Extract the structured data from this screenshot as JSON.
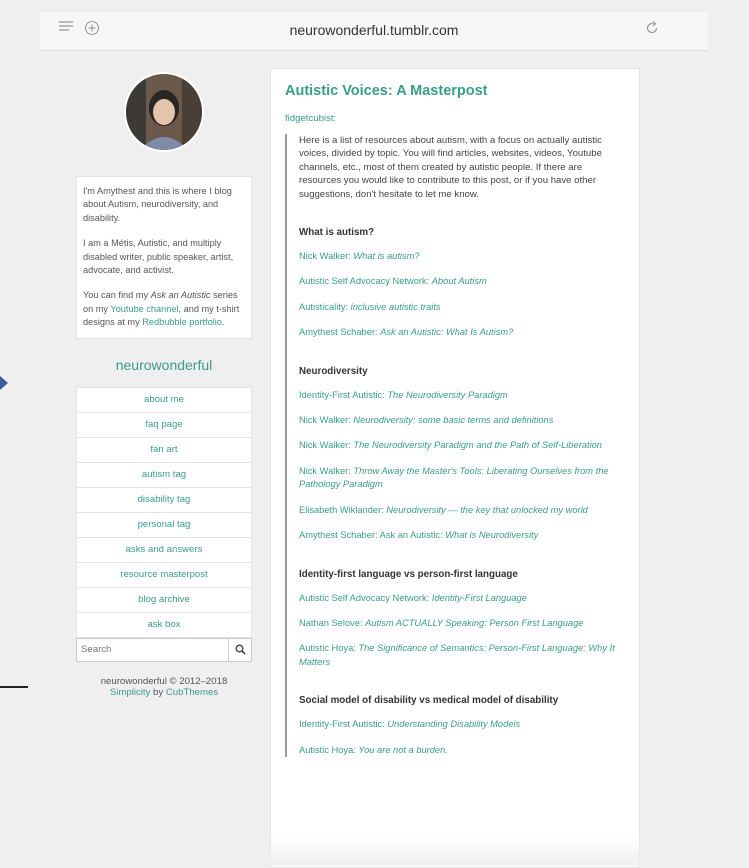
{
  "browser": {
    "url": "neurowonderful.tumblr.com",
    "icons": {
      "reader": "reader-icon",
      "new_tab": "plus-icon",
      "reload": "reload-icon"
    }
  },
  "sidebar": {
    "bio": {
      "p1": "I'm Amythest and this is where I blog about Autism, neurodiversity, and disability.",
      "p2": "I am a Métis, Autistic, and multiply disabled writer, public speaker, artist, advocate, and activist.",
      "p3_pre": "You can find my ",
      "p3_em": "Ask an Autistic",
      "p3_mid": " series on my ",
      "p3_link1": "Youtube channel",
      "p3_mid2": ", and my t-shirt designs at my ",
      "p3_link2": "Redbubble portfolio",
      "p3_end": "."
    },
    "blog_name": "neurowonderful",
    "nav": [
      "about me",
      "faq page",
      "fan art",
      "autism tag",
      "disability tag",
      "personal tag",
      "asks and answers",
      "resource masterpost",
      "blog archive",
      "ask box"
    ],
    "search_placeholder": "Search",
    "footer_copy": "neurowonderful © 2012–2018",
    "footer_theme": "Simplicity",
    "footer_by": " by ",
    "footer_author": "CubThemes"
  },
  "post": {
    "title": "Autistic Voices: A Masterpost",
    "reblog_user": "fidgetcubist:",
    "intro": "Here is a list of resources about autism, with a focus on actually autistic voices, divided by topic. You will find articles, websites, videos, Youtube channels, etc., most of them created by autistic people. If there are resources you would like to contribute to this post, or if you have other suggestions, don't hesitate to let me know.",
    "sections": [
      {
        "heading": "What is autism?",
        "links": [
          {
            "author": "Nick Walker: ",
            "title": "What is autism?"
          },
          {
            "author": "Autistic Self Advocacy Network: ",
            "title": "About Autism"
          },
          {
            "author": "Autisticality: ",
            "title": "inclusive autistic traits"
          },
          {
            "author": "Amythest Schaber: ",
            "title": "Ask an Autistic: What Is Autism?"
          }
        ]
      },
      {
        "heading": "Neurodiversity",
        "links": [
          {
            "author": "Identity-First Autistic: ",
            "title": "The Neurodiversity Paradigm"
          },
          {
            "author": "Nick Walker: ",
            "title": "Neurodiversity: some basic terms and definitions"
          },
          {
            "author": "Nick Walker: ",
            "title": "The Neurodiversity Paradigm and the Path of Self-Liberation"
          },
          {
            "author": "Nick Walker: ",
            "title": "Throw Away the Master's Tools: Liberating Ourselves from the Pathology Paradigm"
          },
          {
            "author": "Elisabeth Wiklander: ",
            "title": "Neurodiversity — the key that unlocked my world"
          },
          {
            "author": "Amythest Schaber: Ask an Autistic: ",
            "title": "What is Neurodiversity"
          }
        ]
      },
      {
        "heading": "Identity-first language vs person-first language",
        "links": [
          {
            "author": "Autistic Self Advocacy Network: ",
            "title": "Identity-First Language"
          },
          {
            "author": "Nathan Selove: ",
            "title": "Autism ACTUALLY Speaking: Person First Language"
          },
          {
            "author": "Autistic Hoya: ",
            "title": "The Significance of Semantics: Person-First Language: Why It Matters"
          }
        ]
      },
      {
        "heading": "Social model of disability vs medical model of disability",
        "links": [
          {
            "author": "Identity-First Autistic: ",
            "title": "Understanding Disability Models"
          },
          {
            "author": "Autistic Hoya: ",
            "title": "You are not a burden."
          }
        ]
      }
    ]
  }
}
